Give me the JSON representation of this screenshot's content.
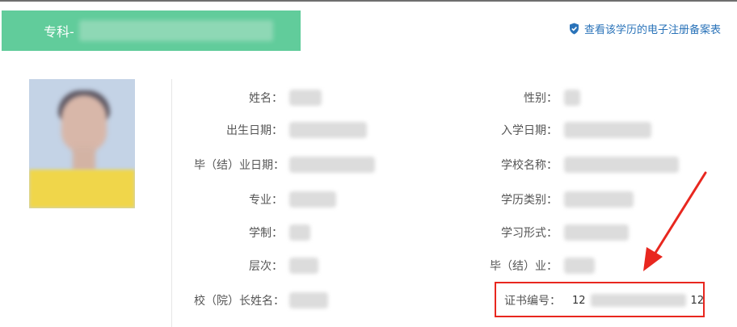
{
  "banner": {
    "title": "专科-"
  },
  "record_link": {
    "label": "查看该学历的电子注册备案表"
  },
  "left_fields": [
    {
      "label": "姓名："
    },
    {
      "label": "出生日期："
    },
    {
      "label": "毕（结）业日期："
    },
    {
      "label": "专业："
    },
    {
      "label": "学制："
    },
    {
      "label": "层次："
    },
    {
      "label": "校（院）长姓名："
    }
  ],
  "right_fields": [
    {
      "label": "性别："
    },
    {
      "label": "入学日期："
    },
    {
      "label": "学校名称："
    },
    {
      "label": "学历类别："
    },
    {
      "label": "学习形式："
    },
    {
      "label": "毕（结）业："
    }
  ],
  "certificate": {
    "label": "证书编号：",
    "prefix": "12",
    "suffix": "12"
  },
  "colors": {
    "banner": "#61cc9b",
    "link": "#2a73b9",
    "highlight": "#e8271f"
  }
}
